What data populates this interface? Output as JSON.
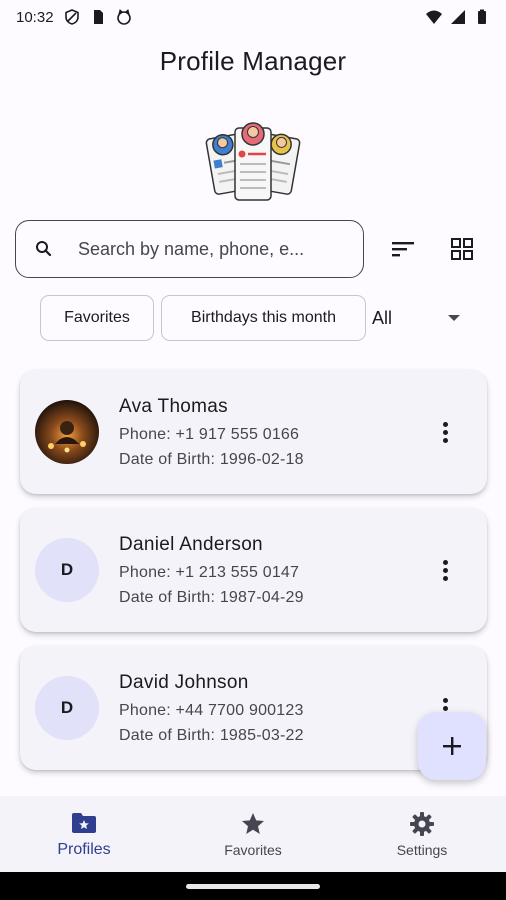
{
  "status_bar": {
    "time": "10:32",
    "left_icons": [
      "shield-icon",
      "sim-card-icon",
      "cat-icon"
    ],
    "right_icons": [
      "wifi-icon",
      "signal-icon",
      "battery-icon"
    ]
  },
  "header": {
    "title": "Profile Manager",
    "illustration": "profiles-illustration"
  },
  "search": {
    "placeholder": "Search by name, phone, e..."
  },
  "toolbar": {
    "sort_icon": "sort-icon",
    "view_icon": "grid-view-icon"
  },
  "filters": {
    "chips": [
      "Favorites",
      "Birthdays this month"
    ],
    "select_value": "All"
  },
  "profiles": [
    {
      "name": "Ava Thomas",
      "phone": "Phone: +1 917 555 0166",
      "dob": "Date of Birth: 1996-02-18",
      "avatar_initial": "",
      "has_photo": true
    },
    {
      "name": "Daniel Anderson",
      "phone": "Phone: +1 213 555 0147",
      "dob": "Date of Birth: 1987-04-29",
      "avatar_initial": "D",
      "has_photo": false
    },
    {
      "name": "David Johnson",
      "phone": "Phone: +44 7700 900123",
      "dob": "Date of Birth: 1985-03-22",
      "avatar_initial": "D",
      "has_photo": false
    }
  ],
  "bottom_nav": {
    "items": [
      {
        "label": "Profiles",
        "icon": "folder-star-icon",
        "active": true
      },
      {
        "label": "Favorites",
        "icon": "star-icon",
        "active": false
      },
      {
        "label": "Settings",
        "icon": "gear-icon",
        "active": false
      }
    ]
  },
  "colors": {
    "accent": "#303e8f",
    "avatar_bg": "#e1e1f9",
    "card_bg": "#f4f3fa",
    "fab_bg": "#e0e0ff"
  }
}
